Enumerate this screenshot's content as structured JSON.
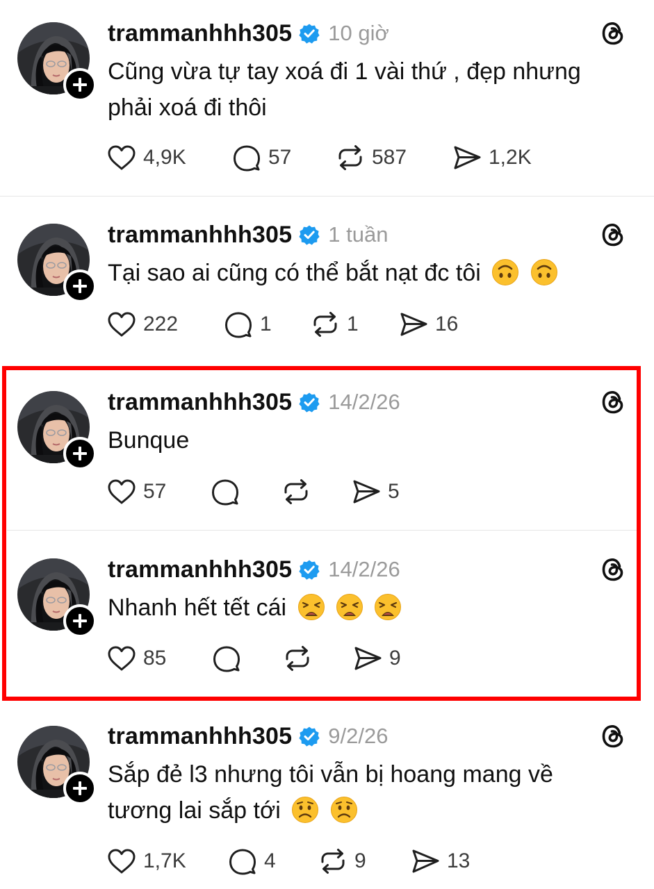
{
  "colors": {
    "verified_badge": "#1d9bf0",
    "highlight_border": "#ff0000",
    "timestamp": "#9a9a9a"
  },
  "posts": [
    {
      "username": "trammanhhh305",
      "time": "10 giờ",
      "text": "Cũng vừa tự tay xoá đi 1 vài thứ , đẹp nhưng phải xoá đi thôi",
      "emoji": [],
      "likes": "4,9K",
      "replies": "57",
      "reposts": "587",
      "shares": "1,2K"
    },
    {
      "username": "trammanhhh305",
      "time": "1 tuần",
      "text": "Tại sao ai cũng có thể bắt nạt đc tôi",
      "emoji": [
        "upside-down-face",
        "upside-down-face"
      ],
      "likes": "222",
      "replies": "1",
      "reposts": "1",
      "shares": "16"
    },
    {
      "username": "trammanhhh305",
      "time": "14/2/26",
      "text": "Bunque",
      "emoji": [],
      "likes": "57",
      "replies": "",
      "reposts": "",
      "shares": "5"
    },
    {
      "username": "trammanhhh305",
      "time": "14/2/26",
      "text": "Nhanh hết tết cái",
      "emoji": [
        "weary-face",
        "weary-face",
        "weary-face"
      ],
      "likes": "85",
      "replies": "",
      "reposts": "",
      "shares": "9"
    },
    {
      "username": "trammanhhh305",
      "time": "9/2/26",
      "text": "Sắp đẻ l3 nhưng tôi vẫn bị hoang mang về tương lai sắp tới",
      "emoji": [
        "worried-face",
        "worried-face"
      ],
      "likes": "1,7K",
      "replies": "4",
      "reposts": "9",
      "shares": "13"
    }
  ]
}
